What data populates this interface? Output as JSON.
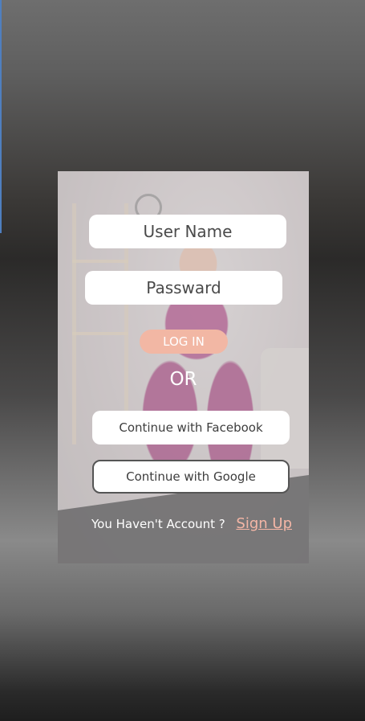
{
  "login": {
    "username_placeholder": "User Name",
    "password_placeholder": "Passward",
    "login_label": "LOG IN",
    "or_label": "OR",
    "facebook_label": "Continue with Facebook",
    "google_label": "Continue with Google",
    "no_account_prompt": "You Haven't Account ?",
    "signup_label": "Sign Up"
  },
  "colors": {
    "accent": "#f2b7a4",
    "signup_link": "#f4b6a6",
    "field_bg": "#ffffff"
  }
}
